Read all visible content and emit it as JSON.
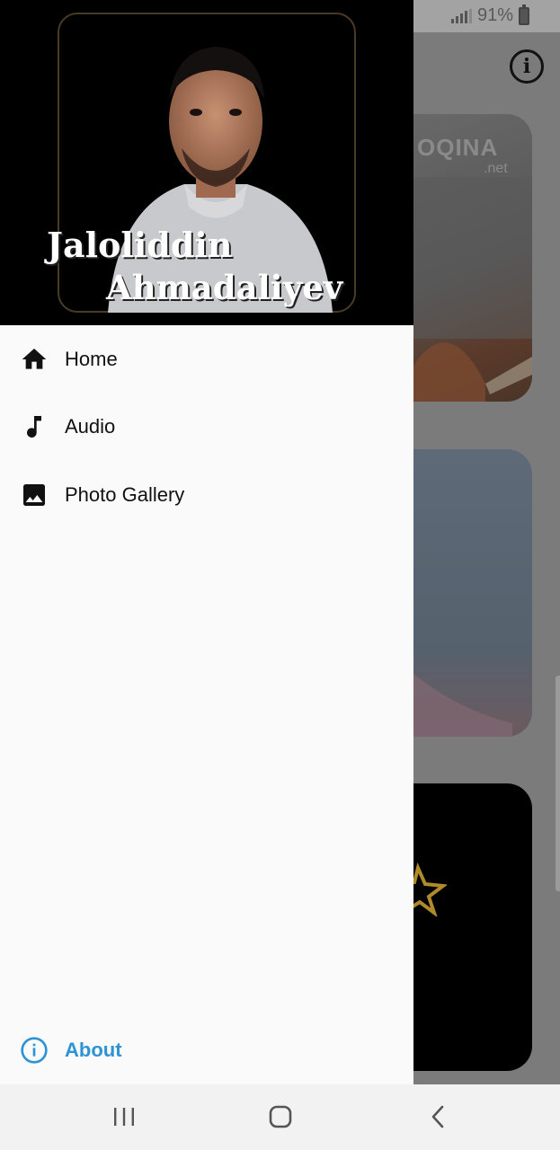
{
  "status_bar": {
    "battery_percent": "91%",
    "icons": [
      "signal-icon",
      "battery-charging-icon"
    ]
  },
  "background": {
    "info_icon": "info-icon",
    "card_watermark": "OQINA",
    "card_watermark_sub": ".net"
  },
  "drawer": {
    "header": {
      "name_line1": "Jaloliddin",
      "name_line2": "Ahmadaliyev"
    },
    "items": [
      {
        "label": "Home",
        "icon": "home-icon"
      },
      {
        "label": "Audio",
        "icon": "music-note-icon"
      },
      {
        "label": "Photo Gallery",
        "icon": "image-icon"
      }
    ],
    "about": {
      "label": "About",
      "icon": "info-icon",
      "color": "#2e93d4"
    }
  },
  "nav_bar": {
    "buttons": [
      "recent-apps-icon",
      "home-circle-icon",
      "back-icon"
    ]
  },
  "colors": {
    "accent": "#2e93d4",
    "drawer_bg": "#fafafa",
    "scrim": "#7b7b7b"
  }
}
